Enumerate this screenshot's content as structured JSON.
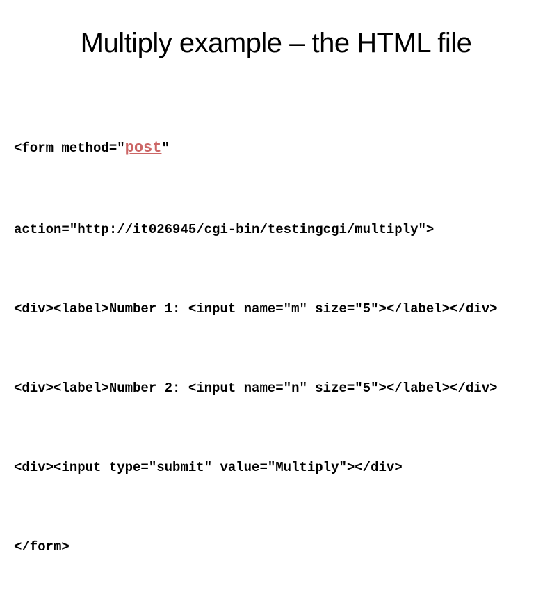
{
  "slide": {
    "title": "Multiply example – the HTML file",
    "code": {
      "line1_pre": "<form method=\"",
      "line1_hl": "post",
      "line1_post": "\"",
      "line2": "action=\"http://it026945/cgi-bin/testingcgi/multiply\">",
      "line3": "<div><label>Number 1: <input name=\"m\" size=\"5\"></label></div>",
      "line4": "<div><label>Number 2: <input name=\"n\" size=\"5\"></label></div>",
      "line5": "<div><input type=\"submit\" value=\"Multiply\"></div>",
      "line6": "</form>"
    }
  }
}
